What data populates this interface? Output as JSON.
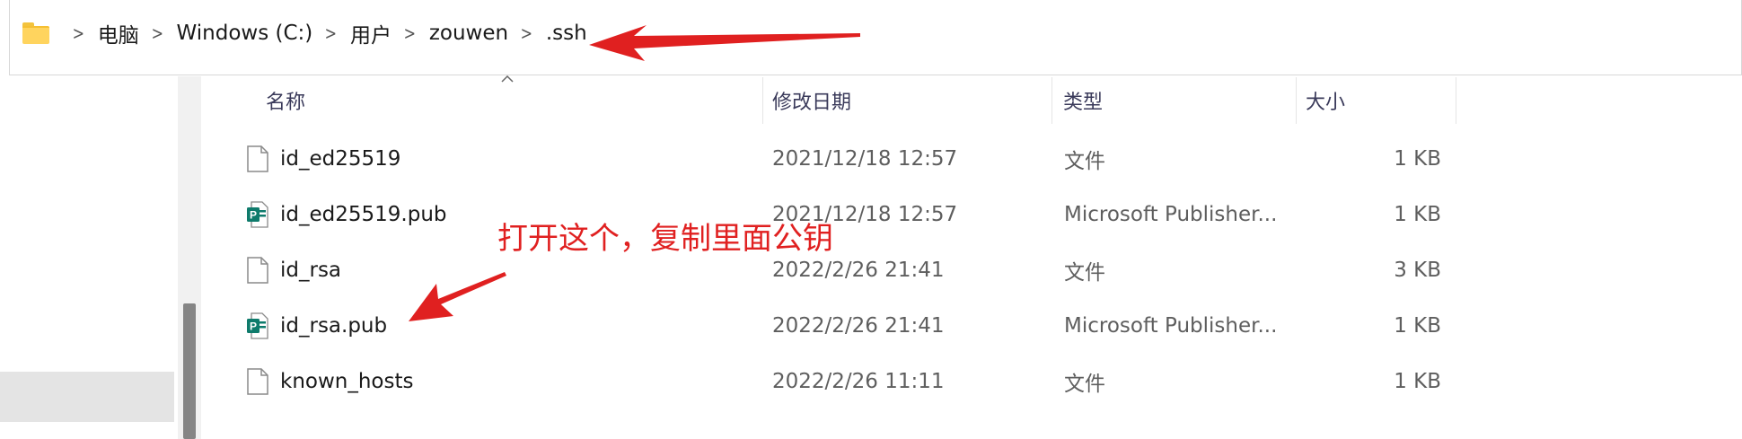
{
  "breadcrumb": {
    "items": [
      "电脑",
      "Windows (C:)",
      "用户",
      "zouwen",
      ".ssh"
    ],
    "icon": "folder-icon",
    "separator_icon": "chevron-right-icon"
  },
  "columns": {
    "name": "名称",
    "date": "修改日期",
    "type": "类型",
    "size": "大小",
    "sorted_by": "name"
  },
  "files": [
    {
      "name": "id_ed25519",
      "date": "2021/12/18 12:57",
      "type": "文件",
      "size": "1 KB",
      "icon": "blank-file-icon"
    },
    {
      "name": "id_ed25519.pub",
      "date": "2021/12/18 12:57",
      "type": "Microsoft Publisher...",
      "size": "1 KB",
      "icon": "publisher-file-icon"
    },
    {
      "name": "id_rsa",
      "date": "2022/2/26 21:41",
      "type": "文件",
      "size": "3 KB",
      "icon": "blank-file-icon"
    },
    {
      "name": "id_rsa.pub",
      "date": "2022/2/26 21:41",
      "type": "Microsoft Publisher...",
      "size": "1 KB",
      "icon": "publisher-file-icon"
    },
    {
      "name": "known_hosts",
      "date": "2022/2/26 11:11",
      "type": "文件",
      "size": "1 KB",
      "icon": "blank-file-icon"
    }
  ],
  "annotation": {
    "text": "打开这个，复制里面公钥",
    "color": "#e02020"
  },
  "colors": {
    "folder": "#ffd45e",
    "publisher_icon": "#0f7b6c",
    "selection": "#e4e4e4",
    "scroll_thumb": "#858585"
  }
}
